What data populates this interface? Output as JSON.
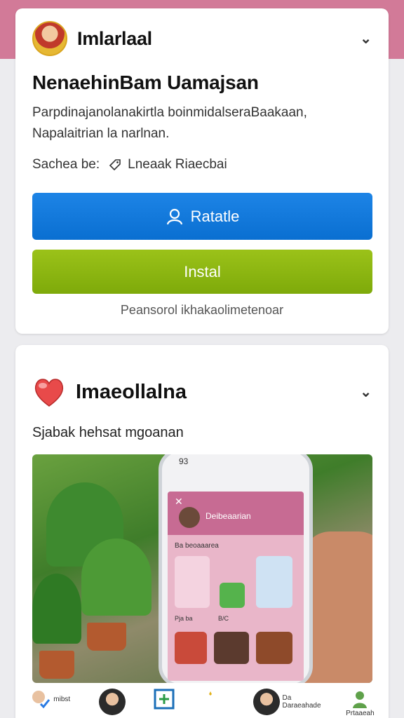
{
  "card1": {
    "app_name": "Imlarlaal",
    "title": "NenaehinBam Uamajsan",
    "description": "Parpdinajanolanakirtla boinmidalseraBaakaan, Napalaitrian la narlnan.",
    "share_label": "Sachea be:",
    "share_target": "Lneaak Riaecbai",
    "primary_button": "Ratatle",
    "install_button": "Instal",
    "footnote": "Peansorol ikhakaolimetenoar",
    "colors": {
      "primary": "#0a6fd1",
      "install": "#7eaa0a"
    }
  },
  "card2": {
    "app_name": "Imaeollalna",
    "subtitle": "Sjabak hehsat mgoanan",
    "phone": {
      "status": "93",
      "screen_title": "Deibeaarian",
      "screen_sub": "Ba beoaaarea",
      "tile_row_label_left": "Pja ba",
      "tile_row_label_right": "B/C"
    }
  },
  "tabbar": {
    "items": [
      {
        "label": "mibst",
        "icon": "avatar-check-icon"
      },
      {
        "label": "",
        "icon": "avatar-icon"
      },
      {
        "label": "",
        "icon": "add-icon"
      },
      {
        "label": "",
        "icon": "sparkle-icon"
      },
      {
        "label": "Da Daraeahade",
        "icon": "avatar-icon"
      },
      {
        "label": "Prtaaeah",
        "icon": "person-icon"
      }
    ]
  }
}
